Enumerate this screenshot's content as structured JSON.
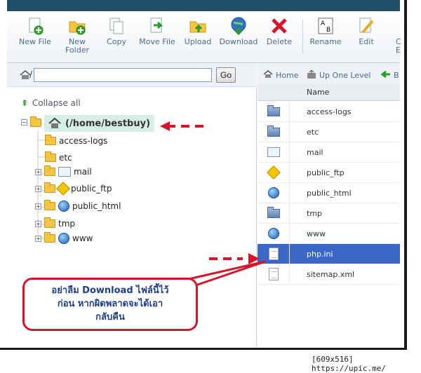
{
  "toolbar": {
    "items": [
      {
        "label": "New File",
        "icon": "new-file-icon"
      },
      {
        "label": "New Folder",
        "icon": "new-folder-icon"
      },
      {
        "label": "Copy",
        "icon": "copy-icon"
      },
      {
        "label": "Move File",
        "icon": "move-file-icon"
      },
      {
        "label": "Upload",
        "icon": "upload-icon"
      },
      {
        "label": "Download",
        "icon": "download-icon"
      },
      {
        "label": "Delete",
        "icon": "delete-icon"
      },
      {
        "label": "Rename",
        "icon": "rename-icon"
      },
      {
        "label": "Edit",
        "icon": "edit-icon"
      },
      {
        "label": "C E",
        "icon": "partial-icon"
      }
    ]
  },
  "left_panel": {
    "path_prefix": "/",
    "path_value": "",
    "go_label": "Go",
    "collapse_label": "Collapse all",
    "root_label": "(/home/bestbuy)",
    "tree": [
      {
        "label": "access-logs",
        "icon": "folder-icon"
      },
      {
        "label": "etc",
        "icon": "folder-icon"
      },
      {
        "label": "mail",
        "icon": "mail-icon"
      },
      {
        "label": "public_ftp",
        "icon": "ftp-icon"
      },
      {
        "label": "public_html",
        "icon": "globe-icon"
      },
      {
        "label": "tmp",
        "icon": "folder-icon"
      },
      {
        "label": "www",
        "icon": "globe-icon"
      }
    ]
  },
  "right_panel": {
    "nav": {
      "home": "Home",
      "up": "Up One Level",
      "back": "B"
    },
    "column_header": "Name",
    "files": [
      {
        "name": "access-logs",
        "icon": "folder-icon",
        "selected": false
      },
      {
        "name": "etc",
        "icon": "folder-icon",
        "selected": false
      },
      {
        "name": "mail",
        "icon": "mail-icon",
        "selected": false
      },
      {
        "name": "public_ftp",
        "icon": "ftp-icon",
        "selected": false
      },
      {
        "name": "public_html",
        "icon": "globe-icon",
        "selected": false
      },
      {
        "name": "tmp",
        "icon": "folder-icon",
        "selected": false
      },
      {
        "name": "www",
        "icon": "globe-icon",
        "selected": false
      },
      {
        "name": "php.ini",
        "icon": "document-icon",
        "selected": true
      },
      {
        "name": "sitemap.xml",
        "icon": "document-icon",
        "selected": false
      }
    ]
  },
  "annotation": {
    "line1": "อย่าลืม Download ไฟล์นี้ไว้",
    "line2": "ก่อน หากผิดพลาดจะได้เอา",
    "line3": "กลับคืน",
    "color": "#d4162a"
  },
  "caption": "[609x516] https://upic.me/"
}
